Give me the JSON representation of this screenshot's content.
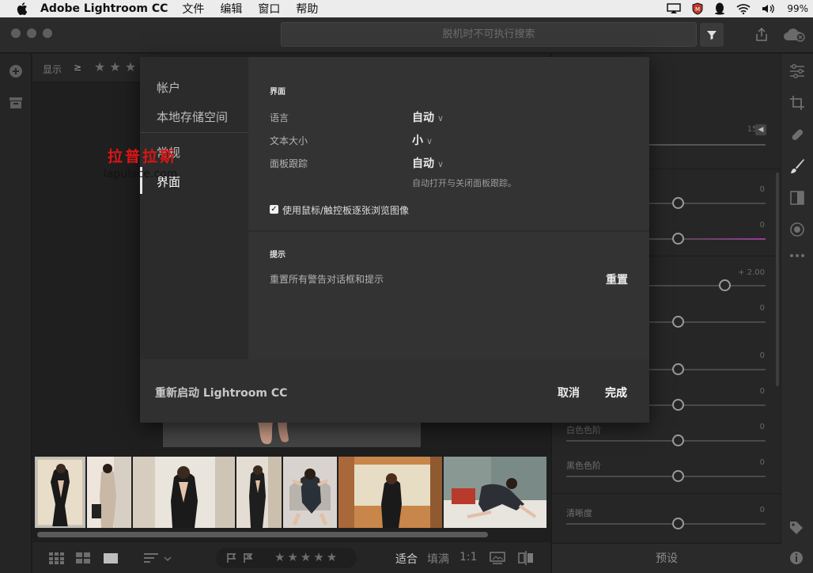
{
  "menubar": {
    "app_name": "Adobe Lightroom CC",
    "menus": [
      "文件",
      "编辑",
      "窗口",
      "帮助"
    ],
    "battery_text": "99%"
  },
  "toolbar": {
    "search_placeholder": "脱机时不可执行搜索"
  },
  "topfilter": {
    "show_label": "显示",
    "operator": "≥"
  },
  "modal": {
    "nav": {
      "account": "帐户",
      "local_storage": "本地存储空间",
      "general": "常规",
      "interface": "界面"
    },
    "interface_section": {
      "title": "界面",
      "language_label": "语言",
      "language_value": "自动",
      "text_size_label": "文本大小",
      "text_size_value": "小",
      "panel_tracking_label": "面板跟踪",
      "panel_tracking_value": "自动",
      "panel_tracking_note": "自动打开与关闭面板跟踪。",
      "checkbox_label": "使用鼠标/触控板逐张浏览图像",
      "checkbox_checked": true
    },
    "tips_section": {
      "title": "提示",
      "reset_label": "重置所有警告对话框和提示",
      "reset_button": "重置"
    },
    "footer": {
      "restart": "重新启动 Lightroom CC",
      "cancel": "取消",
      "done": "完成"
    }
  },
  "bottombar": {
    "fit": "适合",
    "fill": "填满",
    "ratio": "1:1"
  },
  "rightpanel": {
    "top_value": "15.0",
    "values": [
      "0",
      "0",
      "+ 2.00",
      "0",
      "0",
      "0",
      "0",
      "0",
      "0"
    ],
    "white_label": "白色色阶",
    "black_label": "黑色色阶",
    "clarity_label": "清晰度",
    "preset_label": "预设"
  },
  "watermark": {
    "cn": "拉普拉斯",
    "en": "lapulace.com"
  },
  "colors": {
    "accent_white": "#ffffff",
    "panel_bg": "#303030",
    "watermark_red": "#d81616"
  }
}
